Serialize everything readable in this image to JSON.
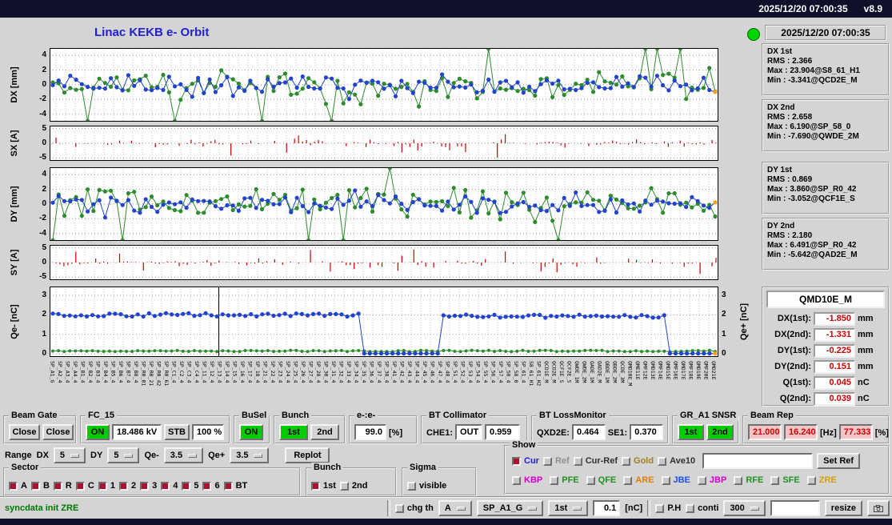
{
  "titlebar": {
    "datetime": "2025/12/20 07:00:35",
    "version": "v8.9"
  },
  "header": {
    "title": "Linac KEKB e- Orbit",
    "timestamp": "2025/12/20 07:00:35"
  },
  "stats": [
    {
      "name": "DX 1st",
      "rms": "RMS : 2.366",
      "max": "Max : 23.904@S8_61_H1",
      "min": "Min : -3.341@QCD2E_M"
    },
    {
      "name": "DX 2nd",
      "rms": "RMS : 2.658",
      "max": "Max : 6.190@SP_58_0",
      "min": "Min : -7.690@QWDE_2M"
    },
    {
      "name": "DY 1st",
      "rms": "RMS : 0.869",
      "max": "Max : 3.860@SP_R0_42",
      "min": "Min : -3.052@QCF1E_S"
    },
    {
      "name": "DY 2nd",
      "rms": "RMS : 2.180",
      "max": "Max : 6.491@SP_R0_42",
      "min": "Min : -5.642@QAD2E_M"
    }
  ],
  "monitor": {
    "title": "QMD10E_M",
    "rows": [
      {
        "label": "DX(1st):",
        "value": "-1.850",
        "unit": "mm"
      },
      {
        "label": "DX(2nd):",
        "value": "-1.331",
        "unit": "mm"
      },
      {
        "label": "DY(1st):",
        "value": "-0.225",
        "unit": "mm"
      },
      {
        "label": "DY(2nd):",
        "value": "0.151",
        "unit": "mm"
      },
      {
        "label": "Q(1st):",
        "value": "0.045",
        "unit": "nC"
      },
      {
        "label": "Q(2nd):",
        "value": "0.039",
        "unit": "nC"
      }
    ]
  },
  "plots": [
    {
      "id": "dx",
      "ylabel": "DX [mm]",
      "ticks": [
        4,
        2,
        0,
        -2,
        -4
      ],
      "ylim": [
        -5,
        5
      ],
      "type": "orbit",
      "seed": 11
    },
    {
      "id": "sx",
      "ylabel": "SX [A]",
      "ticks": [
        5,
        0,
        -5
      ],
      "ylim": [
        -6,
        6
      ],
      "type": "steer",
      "seed": 22
    },
    {
      "id": "dy",
      "ylabel": "DY [mm]",
      "ticks": [
        4,
        2,
        0,
        -2,
        -4
      ],
      "ylim": [
        -5,
        5
      ],
      "type": "orbit",
      "seed": 33
    },
    {
      "id": "sy",
      "ylabel": "SY [A]",
      "ticks": [
        5,
        0,
        -5
      ],
      "ylim": [
        -6,
        6
      ],
      "type": "steer",
      "seed": 44
    },
    {
      "id": "q",
      "ylabel": "Qe- [nC]",
      "ylabel_right": "Qe+ [nC]",
      "ticks": [
        3,
        2,
        1,
        0
      ],
      "ylim": [
        -0.15,
        3.45
      ],
      "type": "charge",
      "seed": 55
    }
  ],
  "xlabels": [
    "SP_A1_G",
    "SP_A2_4",
    "SP_A3_4",
    "SP_A4_4",
    "SP_B1_4",
    "SP_B2_4",
    "SP_B3_4",
    "SP_B4_4",
    "SP_B5_4",
    "SP_B6_4",
    "SP_B7_4",
    "SP_B8_4",
    "SP_R0_01",
    "SP_R0_21",
    "SP_R0_42",
    "SP_R0_61",
    "SP_C1_4",
    "SP_C2_4",
    "SP_C3_4",
    "SP_C4_4",
    "SP_11_4",
    "SP_12_4",
    "SP_13_4",
    "SP_14_4",
    "SP_15_4",
    "SP_16_4",
    "SP_17_4",
    "SP_18_4",
    "SP_21_4",
    "SP_22_4",
    "SP_23_4",
    "SP_24_4",
    "SP_25_4",
    "SP_26_4",
    "SP_27_4",
    "SP_28_4",
    "SP_30_4",
    "SP_31_4",
    "SP_32_4",
    "SP_33_4",
    "SP_34_4",
    "SP_35_4",
    "SP_36_4",
    "SP_37_4",
    "SP_38_4",
    "SP_41_4",
    "SP_42_4",
    "SP_43_4",
    "SP_44_4",
    "SP_45_4",
    "SP_46_4",
    "SP_47_4",
    "SP_48_4",
    "SP_51_4",
    "SP_52_4",
    "SP_53_4",
    "SP_54_4",
    "SP_55_4",
    "SP_56_4",
    "SP_57_4",
    "SP_58_4",
    "SP_58_0",
    "SP_61_4",
    "S8_61_H1",
    "SP_61_H2",
    "QCD1E_M",
    "QCD2E_M",
    "QCF1E_S",
    "QCF2E_S",
    "QWDE_1M",
    "QWDE_2M",
    "QADE_1M",
    "QAD2E_M",
    "QBDE_1M",
    "QBDE_2M",
    "QCDE_3M",
    "QMD10E_M",
    "QME11E",
    "QMF12E",
    "QMD13E",
    "QMF14E",
    "QMD15E",
    "QMF16E",
    "QMD17E",
    "QMF18E",
    "QMD19E",
    "QMF20E",
    "QMD21E"
  ],
  "controls": {
    "beam_gate": {
      "title": "Beam Gate",
      "btn1": "Close",
      "btn2": "Close"
    },
    "fc15": {
      "title": "FC_15",
      "on": "ON",
      "kv": "18.486 kV",
      "stb": "STB",
      "pct": "100 %"
    },
    "busel": {
      "title": "BuSel",
      "on": "ON"
    },
    "bunch": {
      "title": "Bunch",
      "first": "1st",
      "second": "2nd"
    },
    "ee": {
      "title": "e-:e-",
      "value": "99.0",
      "unit": "[%]"
    },
    "bt_collimator": {
      "title": "BT Collimator",
      "che1_label": "CHE1:",
      "che1_state": "OUT",
      "che1_value": "0.959"
    },
    "bt_lossmonitor": {
      "title": "BT LossMonitor",
      "qxd2e_label": "QXD2E:",
      "qxd2e_value": "0.464",
      "se1_label": "SE1:",
      "se1_value": "0.370"
    },
    "gr_snsr": {
      "title": "GR_A1 SNSR",
      "first": "1st",
      "second": "2nd"
    },
    "beam_rep": {
      "title": "Beam Rep",
      "v1": "21.000",
      "v2": "16.240",
      "hz": "[Hz]",
      "v3": "77.333",
      "pct": "[%]"
    }
  },
  "range": {
    "label": "Range",
    "items": [
      {
        "label": "DX",
        "value": "5"
      },
      {
        "label": "DY",
        "value": "5"
      },
      {
        "label": "Qe-",
        "value": "3.5"
      },
      {
        "label": "Qe+",
        "value": "3.5"
      }
    ],
    "replot": "Replot"
  },
  "sector": {
    "title": "Sector",
    "items": [
      "A",
      "B",
      "R",
      "C",
      "1",
      "2",
      "3",
      "4",
      "5",
      "6",
      "BT"
    ]
  },
  "bunch_sel": {
    "title": "Bunch",
    "items": [
      {
        "label": "1st",
        "checked": true
      },
      {
        "label": "2nd",
        "checked": false
      }
    ]
  },
  "sigma": {
    "title": "Sigma",
    "items": [
      {
        "label": "visible",
        "checked": false
      }
    ]
  },
  "show": {
    "title": "Show",
    "row1": [
      {
        "label": "Cur",
        "checked": true,
        "color": "#2020cc"
      },
      {
        "label": "Ref",
        "checked": false,
        "color": "#909090"
      },
      {
        "label": "Cur-Ref",
        "checked": false,
        "color": "#303030"
      },
      {
        "label": "Gold",
        "checked": false,
        "color": "#a08020"
      },
      {
        "label": "Ave10",
        "checked": false,
        "color": "#303030"
      }
    ],
    "ref_input_value": "",
    "setref_label": "Set Ref",
    "row2": [
      {
        "label": "KBP",
        "checked": false,
        "color": "#cc00cc"
      },
      {
        "label": "PFE",
        "checked": false,
        "color": "#209020"
      },
      {
        "label": "QFE",
        "checked": false,
        "color": "#209020"
      },
      {
        "label": "ARE",
        "checked": false,
        "color": "#e08000"
      },
      {
        "label": "JBE",
        "checked": false,
        "color": "#2050e0"
      },
      {
        "label": "JBP",
        "checked": false,
        "color": "#cc00cc"
      },
      {
        "label": "RFE",
        "checked": false,
        "color": "#209020"
      },
      {
        "label": "SFE",
        "checked": false,
        "color": "#209020"
      },
      {
        "label": "ZRE",
        "checked": false,
        "color": "#d0a000"
      }
    ]
  },
  "statusbar": {
    "status": "syncdata init ZRE",
    "chg_th": "chg th",
    "menu_a": "A",
    "menu_sp": "SP_A1_G",
    "menu_bunch": "1st",
    "threshold": "0.1",
    "unit": "[nC]",
    "ph": "P.H",
    "conti": "conti",
    "menu_300": "300",
    "resize": "resize"
  },
  "colors": {
    "green": "#2e8b2e",
    "blue": "#2244cc",
    "red": "#cc0000",
    "orange": "#ffa000",
    "on_green": "#00cc00"
  }
}
